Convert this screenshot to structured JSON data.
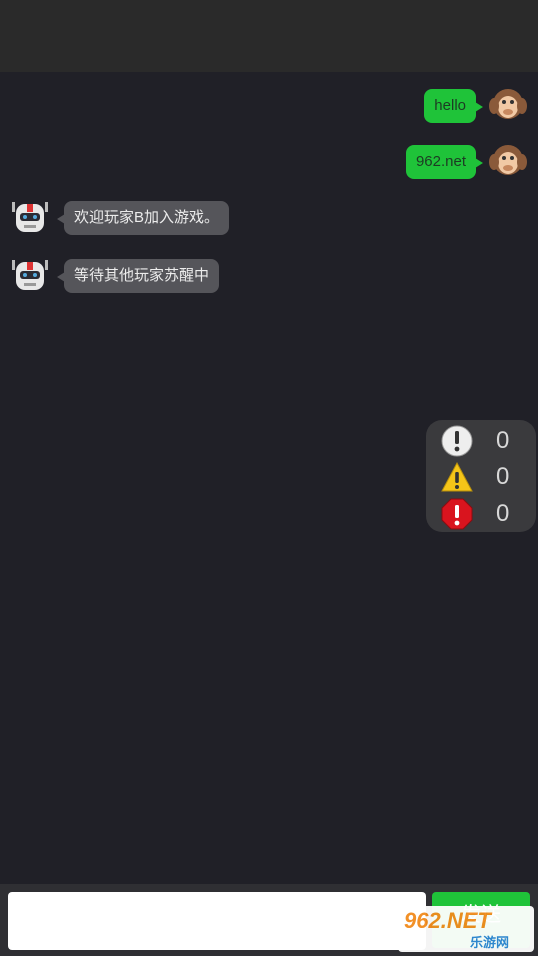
{
  "messages": [
    {
      "side": "right",
      "text": "hello",
      "avatar": "monkey-avatar"
    },
    {
      "side": "right",
      "text": "962.net",
      "avatar": "monkey-avatar"
    },
    {
      "side": "left",
      "text": "欢迎玩家B加入游戏。",
      "avatar": "robot-avatar"
    },
    {
      "side": "left",
      "text": "等待其他玩家苏醒中",
      "avatar": "robot-avatar"
    }
  ],
  "stats": {
    "info_count": "0",
    "warning_count": "0",
    "error_count": "0"
  },
  "composer": {
    "input_value": "",
    "send_label": "发送"
  },
  "watermark": {
    "brand": "962.NET",
    "sub": "乐游网"
  },
  "colors": {
    "background": "#202027",
    "accent_green": "#1fc339",
    "bot_bubble": "#55555a"
  }
}
